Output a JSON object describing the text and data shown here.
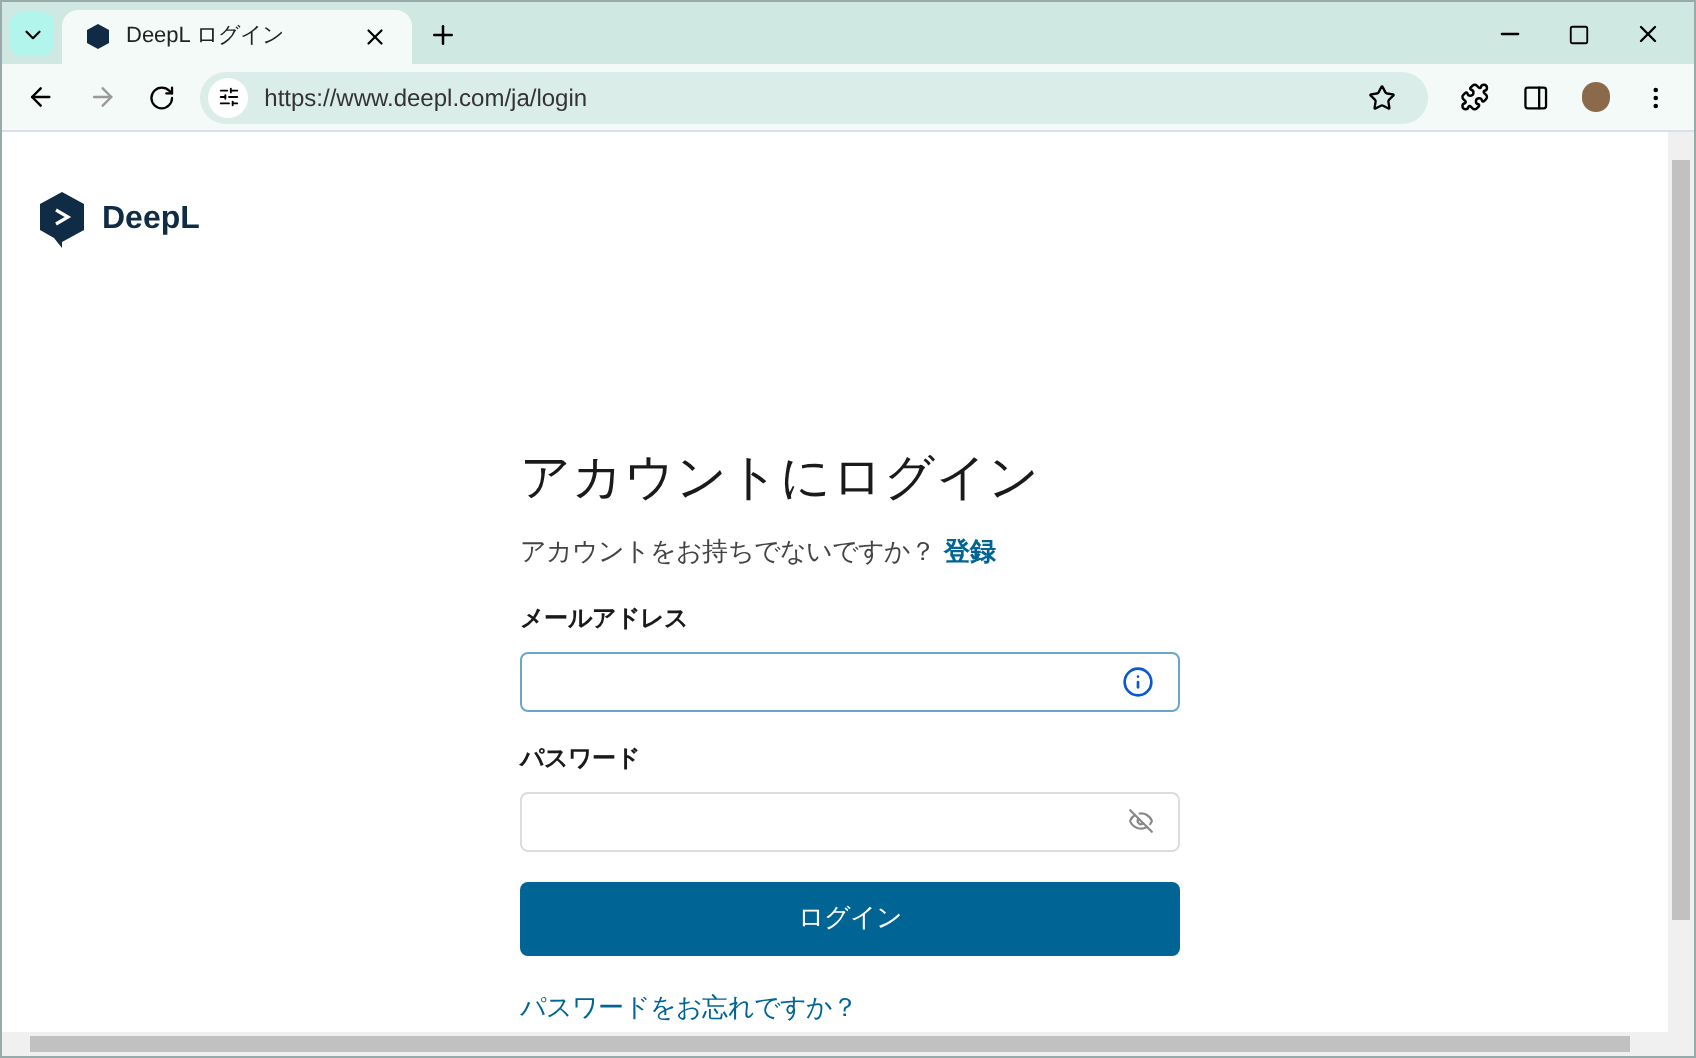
{
  "browser": {
    "tab": {
      "title": "DeepL ログイン",
      "selected": true
    },
    "url": "https://www.deepl.com/ja/login"
  },
  "logo": {
    "text": "DeepL"
  },
  "login": {
    "heading": "アカウントにログイン",
    "prompt": "アカウントをお持ちでないですか？",
    "signup_link": "登録",
    "fields": [
      {
        "label": "メールアドレス",
        "kind": "email",
        "focused": true
      },
      {
        "label": "パスワード",
        "kind": "password",
        "focused": false
      }
    ],
    "submit": "ログイン",
    "forgot_link": "パスワードをお忘れですか？"
  }
}
